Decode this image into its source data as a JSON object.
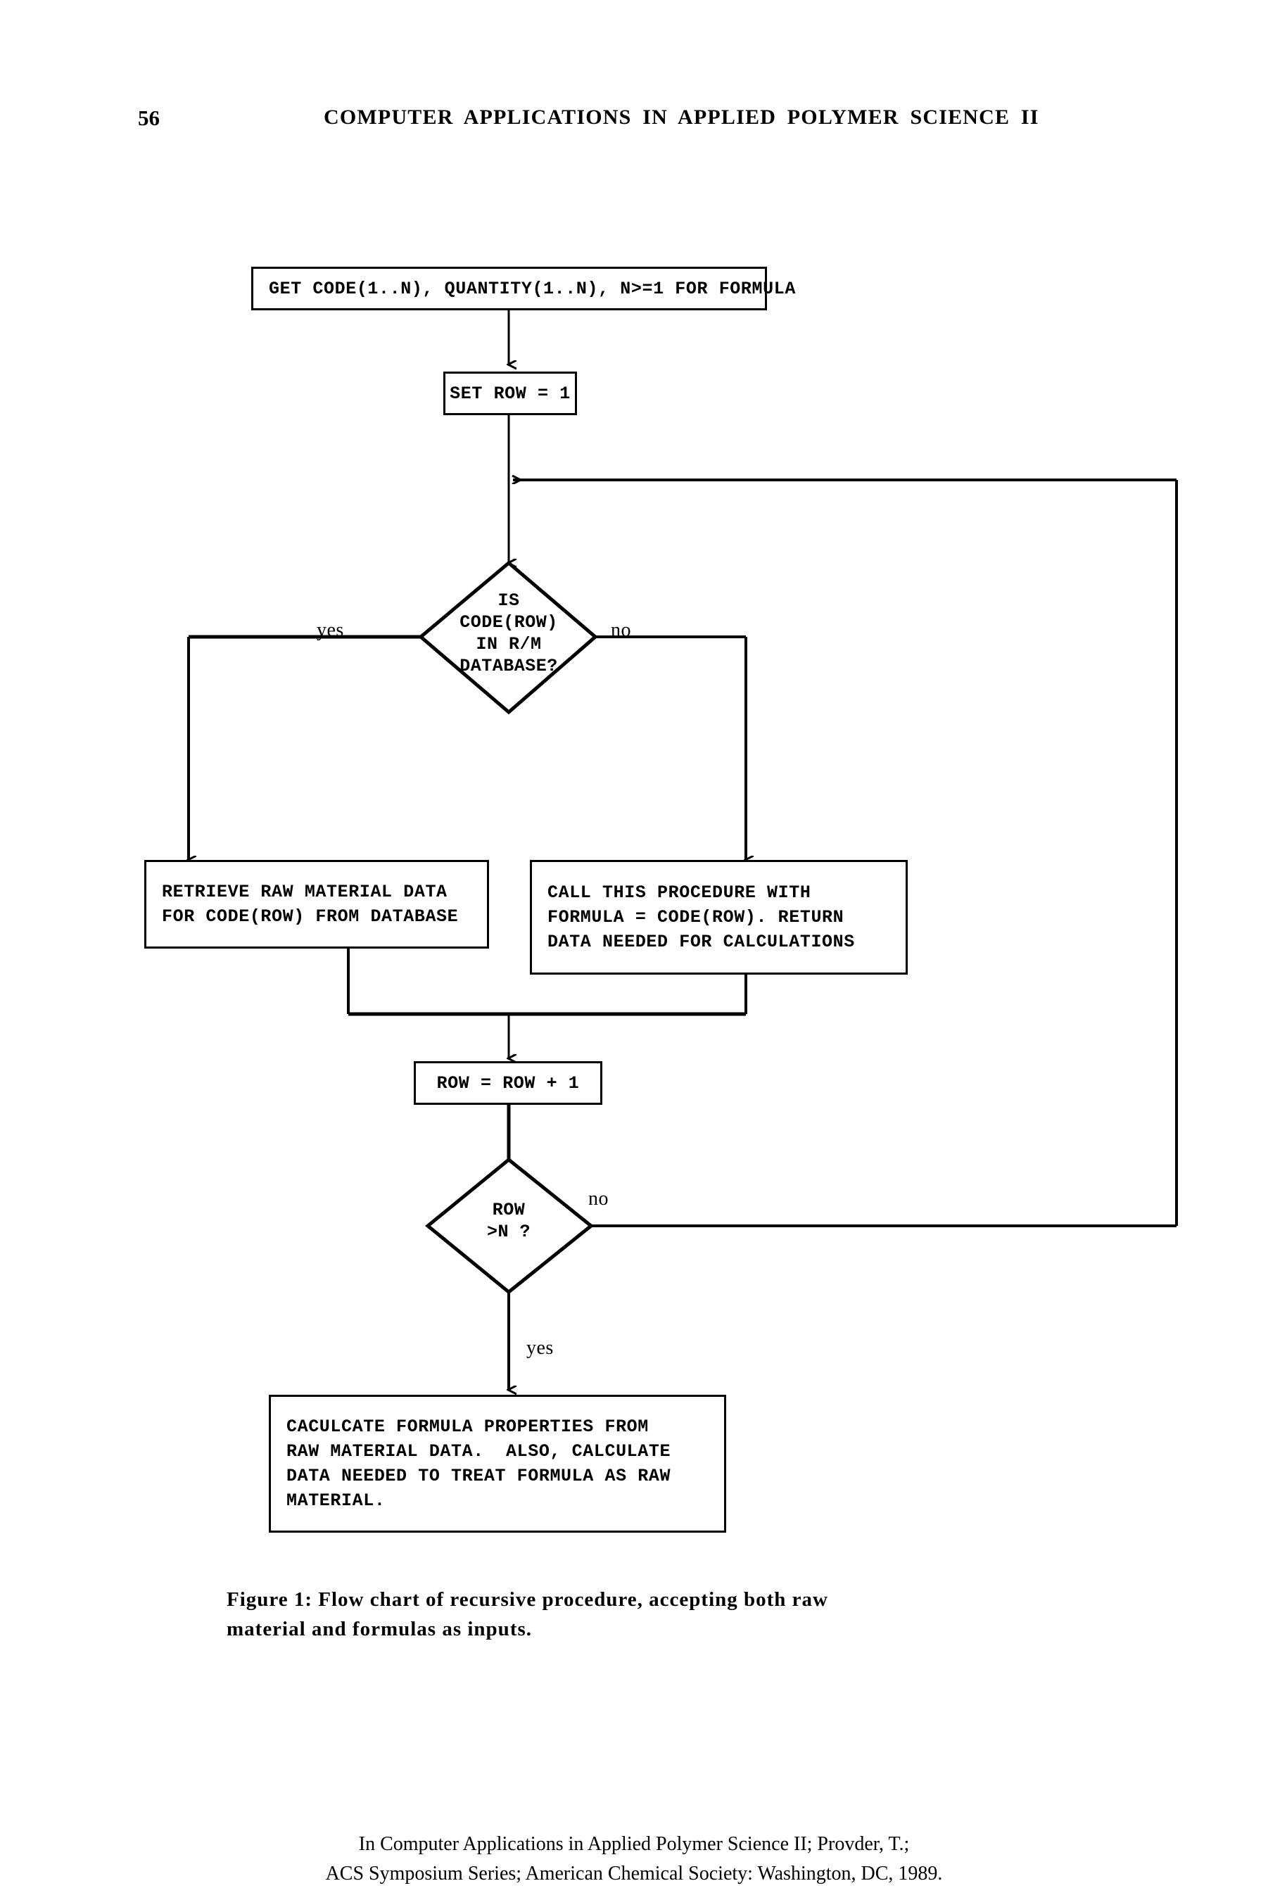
{
  "header": {
    "page_number": "56",
    "title": "COMPUTER APPLICATIONS IN APPLIED POLYMER SCIENCE II"
  },
  "flowchart": {
    "nodes": {
      "get_code": {
        "id": "get-code-box",
        "shape": "process",
        "lines": [
          "GET CODE(1..N), QUANTITY(1..N), N>=1 FOR FORMULA"
        ],
        "text": "GET CODE(1..N), QUANTITY(1..N), N>=1 FOR FORMULA"
      },
      "set_row": {
        "id": "set-row-box",
        "shape": "process",
        "lines": [
          "SET ROW = 1"
        ],
        "text": "SET ROW = 1"
      },
      "is_code_in_db": {
        "id": "is-code-in-database-decision",
        "shape": "decision",
        "lines": [
          "IS",
          "CODE(ROW)",
          "IN R/M",
          "DATABASE?"
        ],
        "text": "IS\nCODE(ROW)\nIN R/M\nDATABASE?"
      },
      "retrieve": {
        "id": "retrieve-raw-material-box",
        "shape": "process",
        "lines": [
          "RETRIEVE RAW MATERIAL DATA",
          "FOR CODE(ROW) FROM DATABASE"
        ],
        "text": "RETRIEVE RAW MATERIAL DATA\nFOR CODE(ROW) FROM DATABASE"
      },
      "call_proc": {
        "id": "call-procedure-box",
        "shape": "process",
        "lines": [
          "CALL THIS PROCEDURE WITH",
          "FORMULA = CODE(ROW). RETURN",
          "DATA NEEDED FOR CALCULATIONS"
        ],
        "text": "CALL THIS PROCEDURE WITH\nFORMULA = CODE(ROW). RETURN\nDATA NEEDED FOR CALCULATIONS"
      },
      "increment": {
        "id": "increment-row-box",
        "shape": "process",
        "lines": [
          "ROW = ROW + 1"
        ],
        "text": "ROW = ROW + 1"
      },
      "row_gt_n": {
        "id": "row-greater-than-n-decision",
        "shape": "decision",
        "lines": [
          "ROW",
          ">N ?"
        ],
        "text": "ROW\n>N ?"
      },
      "calculate": {
        "id": "calculate-formula-properties-box",
        "shape": "process",
        "lines": [
          "CACULCATE FORMULA PROPERTIES FROM",
          "RAW MATERIAL DATA.  ALSO, CALCULATE",
          "DATA NEEDED TO TREAT FORMULA AS RAW",
          "MATERIAL."
        ],
        "text": "CACULCATE FORMULA PROPERTIES FROM\nRAW MATERIAL DATA.  ALSO, CALCULATE\nDATA NEEDED TO TREAT FORMULA AS RAW\nMATERIAL."
      }
    },
    "edge_labels": {
      "db_yes": "yes",
      "db_no": "no",
      "row_no": "no",
      "row_yes": "yes"
    },
    "line_color": "#000000"
  },
  "caption": {
    "line1": "Figure 1:  Flow chart of recursive procedure, accepting both raw",
    "line2": "material and formulas as inputs."
  },
  "footer": {
    "line1": "In Computer Applications in Applied Polymer Science II; Provder, T.;",
    "line2": "ACS Symposium Series; American Chemical Society: Washington, DC, 1989."
  }
}
